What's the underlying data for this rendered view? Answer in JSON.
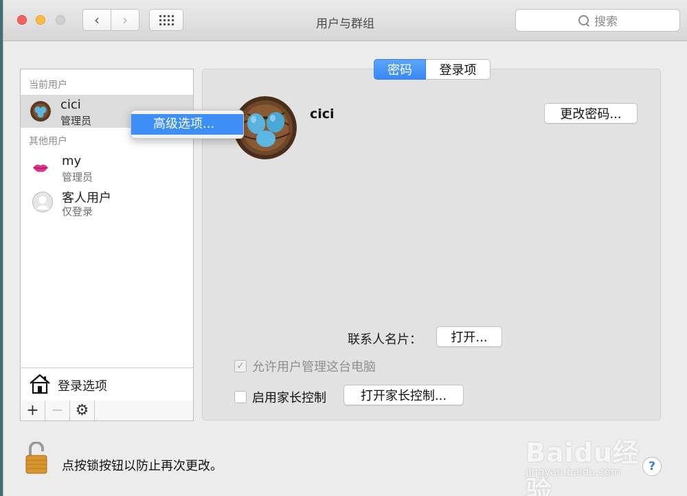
{
  "window": {
    "title": "用户与群组",
    "search_placeholder": "搜索"
  },
  "sidebar": {
    "current_users_label": "当前用户",
    "other_users_label": "其他用户",
    "users": [
      {
        "name": "cici",
        "role": "管理员"
      },
      {
        "name": "my",
        "role": "管理员"
      },
      {
        "name": "客人用户",
        "role": "仅登录"
      }
    ],
    "login_options_label": "登录选项",
    "toolbar": {
      "add": "+",
      "remove": "−",
      "gear": "⚙"
    }
  },
  "context_menu": {
    "item": "高级选项..."
  },
  "tabs": [
    {
      "label": "密码"
    },
    {
      "label": "登录项"
    }
  ],
  "detail": {
    "username": "cici",
    "change_password_label": "更改密码...",
    "contact_card_label": "联系人名片：",
    "open_label": "打开...",
    "allow_admin_label": "允许用户管理这台电脑",
    "allow_admin_checked": true,
    "parental_label": "启用家长控制",
    "parental_checked": false,
    "open_parental_label": "打开家长控制..."
  },
  "footer": {
    "lock_text": "点按锁按钮以防止再次更改。",
    "help": "?"
  },
  "watermark": {
    "brand": "Baidu经验",
    "url": "jingyan.baidu.com"
  },
  "colors": {
    "accent": "#3a87f5",
    "close": "#fc605c",
    "minimize": "#fdbc40"
  }
}
